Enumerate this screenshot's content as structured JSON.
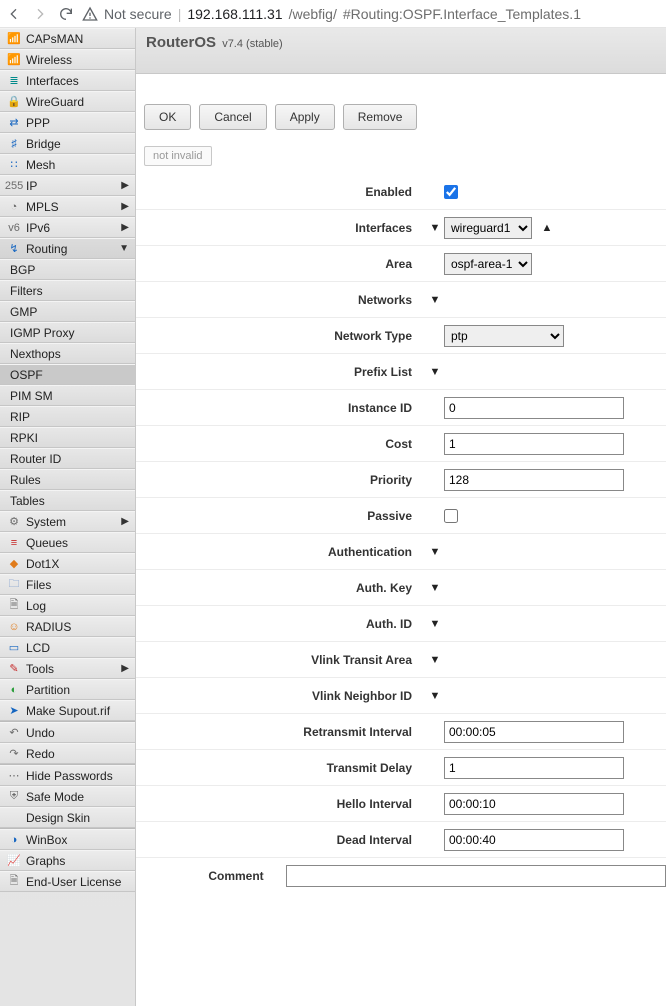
{
  "browser": {
    "not_secure": "Not secure",
    "host": "192.168.111.31",
    "path": "/webfig/",
    "hash": "#Routing:OSPF.Interface_Templates.1"
  },
  "header": {
    "title": "RouterOS",
    "version": "v7.4 (stable)"
  },
  "toolbar": {
    "ok": "OK",
    "cancel": "Cancel",
    "apply": "Apply",
    "remove": "Remove"
  },
  "status": {
    "not_invalid": "not invalid"
  },
  "sidebar": {
    "items": [
      {
        "label": "CAPsMAN",
        "icon": "📶",
        "cls": "i-gray"
      },
      {
        "label": "Wireless",
        "icon": "📶",
        "cls": "i-green"
      },
      {
        "label": "Interfaces",
        "icon": "≣",
        "cls": "i-teal"
      },
      {
        "label": "WireGuard",
        "icon": "🔒",
        "cls": "i-gray"
      },
      {
        "label": "PPP",
        "icon": "⇄",
        "cls": "i-blue"
      },
      {
        "label": "Bridge",
        "icon": "♯",
        "cls": "i-blue"
      },
      {
        "label": "Mesh",
        "icon": "∷",
        "cls": "i-blue"
      },
      {
        "label": "IP",
        "icon": "255",
        "cls": "i-gray",
        "expand": true
      },
      {
        "label": "MPLS",
        "icon": "◔",
        "cls": "i-gray",
        "expand": true
      },
      {
        "label": "IPv6",
        "icon": "v6",
        "cls": "i-gray",
        "expand": true
      },
      {
        "label": "Routing",
        "icon": "↯",
        "cls": "i-blue",
        "expand": true,
        "open": true,
        "sub": [
          "BGP",
          "Filters",
          "GMP",
          "IGMP Proxy",
          "Nexthops",
          "OSPF",
          "PIM SM",
          "RIP",
          "RPKI",
          "Router ID",
          "Rules",
          "Tables"
        ],
        "active_sub": "OSPF"
      },
      {
        "label": "System",
        "icon": "⚙",
        "cls": "i-gray",
        "expand": true
      },
      {
        "label": "Queues",
        "icon": "≡",
        "cls": "i-red"
      },
      {
        "label": "Dot1X",
        "icon": "◆",
        "cls": "i-orange"
      },
      {
        "label": "Files",
        "icon": "🗀",
        "cls": "i-folder"
      },
      {
        "label": "Log",
        "icon": "🗎",
        "cls": "i-gray"
      },
      {
        "label": "RADIUS",
        "icon": "☺",
        "cls": "i-orange"
      },
      {
        "label": "LCD",
        "icon": "▭",
        "cls": "i-blue"
      },
      {
        "label": "Tools",
        "icon": "✎",
        "cls": "i-red",
        "expand": true
      },
      {
        "label": "Partition",
        "icon": "◐",
        "cls": "i-green"
      },
      {
        "label": "Make Supout.rif",
        "icon": "➤",
        "cls": "i-blue"
      },
      {
        "sep": true
      },
      {
        "label": "Undo",
        "icon": "↶",
        "cls": "i-gray"
      },
      {
        "label": "Redo",
        "icon": "↷",
        "cls": "i-gray"
      },
      {
        "sep": true
      },
      {
        "label": "Hide Passwords",
        "icon": "⋯",
        "cls": "i-gray"
      },
      {
        "label": "Safe Mode",
        "icon": "⛨",
        "cls": "i-gray"
      },
      {
        "label": "Design Skin",
        "icon": "",
        "cls": "i-gray"
      },
      {
        "sep": true
      },
      {
        "label": "WinBox",
        "icon": "◑",
        "cls": "i-blue"
      },
      {
        "label": "Graphs",
        "icon": "📈",
        "cls": "i-green"
      },
      {
        "label": "End-User License",
        "icon": "🗎",
        "cls": "i-gray"
      }
    ]
  },
  "form": {
    "enabled": {
      "label": "Enabled",
      "value": true
    },
    "interfaces": {
      "label": "Interfaces",
      "value": "wireguard1",
      "options": [
        "wireguard1"
      ]
    },
    "area": {
      "label": "Area",
      "value": "ospf-area-1",
      "options": [
        "ospf-area-1"
      ]
    },
    "networks": {
      "label": "Networks"
    },
    "network_type": {
      "label": "Network Type",
      "value": "ptp",
      "options": [
        "ptp"
      ]
    },
    "prefix_list": {
      "label": "Prefix List"
    },
    "instance_id": {
      "label": "Instance ID",
      "value": "0"
    },
    "cost": {
      "label": "Cost",
      "value": "1"
    },
    "priority": {
      "label": "Priority",
      "value": "128"
    },
    "passive": {
      "label": "Passive",
      "value": false
    },
    "authentication": {
      "label": "Authentication"
    },
    "auth_key": {
      "label": "Auth. Key"
    },
    "auth_id": {
      "label": "Auth. ID"
    },
    "vlink_transit_area": {
      "label": "Vlink Transit Area"
    },
    "vlink_neighbor_id": {
      "label": "Vlink Neighbor ID"
    },
    "retransmit_interval": {
      "label": "Retransmit Interval",
      "value": "00:00:05"
    },
    "transmit_delay": {
      "label": "Transmit Delay",
      "value": "1"
    },
    "hello_interval": {
      "label": "Hello Interval",
      "value": "00:00:10"
    },
    "dead_interval": {
      "label": "Dead Interval",
      "value": "00:00:40"
    },
    "comment": {
      "label": "Comment",
      "value": ""
    }
  }
}
